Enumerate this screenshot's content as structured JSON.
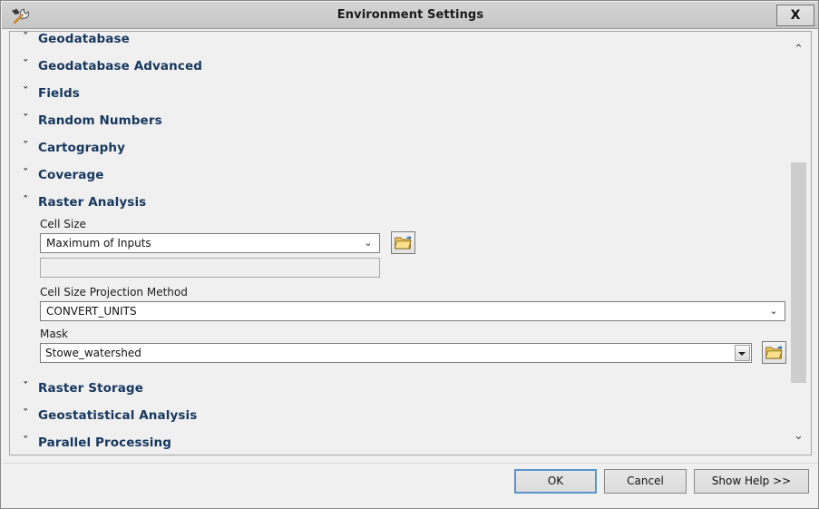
{
  "window": {
    "title": "Environment Settings",
    "icon": "tools-hammer-wrench-icon",
    "close_label": "X"
  },
  "scrollbar": {
    "up_arrow": "⌃",
    "down_arrow": "⌄"
  },
  "chevrons": {
    "collapsed": "ˇ",
    "expanded": "ˆ"
  },
  "sections": [
    {
      "label": "Geodatabase",
      "expanded": false
    },
    {
      "label": "Geodatabase Advanced",
      "expanded": false
    },
    {
      "label": "Fields",
      "expanded": false
    },
    {
      "label": "Random Numbers",
      "expanded": false
    },
    {
      "label": "Cartography",
      "expanded": false
    },
    {
      "label": "Coverage",
      "expanded": false
    },
    {
      "label": "Raster Analysis",
      "expanded": true
    },
    {
      "label": "Raster Storage",
      "expanded": false
    },
    {
      "label": "Geostatistical Analysis",
      "expanded": false
    },
    {
      "label": "Parallel Processing",
      "expanded": false
    }
  ],
  "raster_analysis": {
    "cell_size": {
      "label": "Cell Size",
      "value": "Maximum of Inputs",
      "placeholder": "",
      "arrow": "⌄",
      "browse_icon": "folder-browse-icon",
      "custom_value": "",
      "custom_placeholder": ""
    },
    "cell_size_projection_method": {
      "label": "Cell Size Projection Method",
      "value": "CONVERT_UNITS",
      "arrow": "⌄"
    },
    "mask": {
      "label": "Mask",
      "value": "Stowe_watershed",
      "browse_icon": "folder-browse-icon"
    }
  },
  "buttons": {
    "ok": "OK",
    "cancel": "Cancel",
    "show_help": "Show Help >>"
  },
  "colors": {
    "section_title": "#17375e",
    "titlebar": "#cdcdcd",
    "dialog_bg": "#f0f0f0",
    "focus_border": "#5b94cb",
    "scroll_thumb": "#cdcdcd"
  }
}
